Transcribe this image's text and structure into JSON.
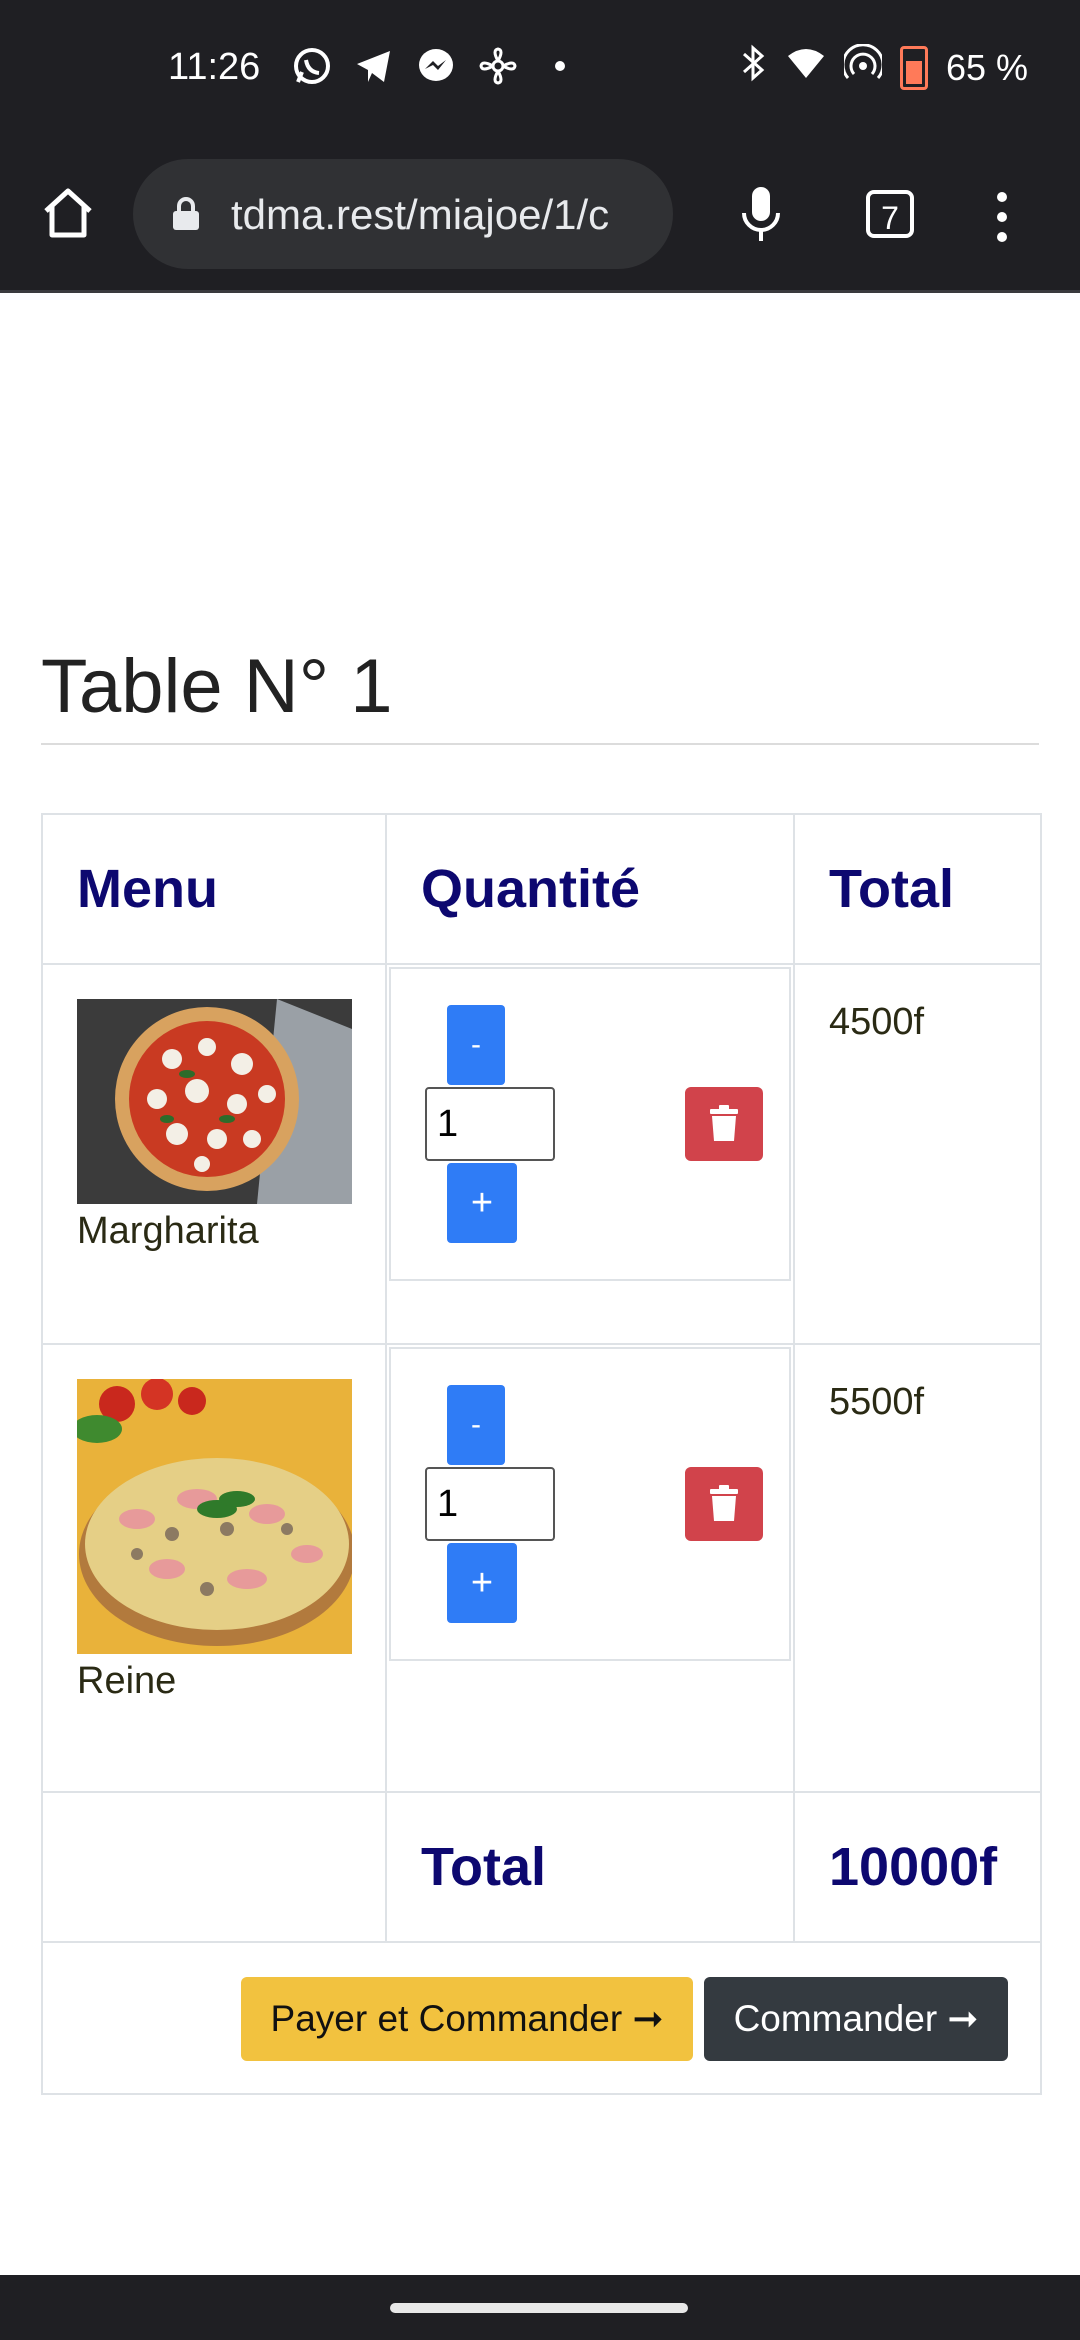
{
  "status_bar": {
    "time": "11:26",
    "battery": "65 %",
    "notification_icons": [
      "whatsapp-icon",
      "telegram-icon",
      "messenger-icon",
      "pinwheel-icon",
      "dot-icon"
    ],
    "system_icons": [
      "bluetooth-icon",
      "wifi-icon",
      "hotspot-icon",
      "battery-icon"
    ]
  },
  "browser": {
    "url": "tdma.rest/miajoe/1/c",
    "tab_count": "7"
  },
  "page": {
    "title": "Table N° 1",
    "table": {
      "headers": {
        "menu": "Menu",
        "quantity": "Quantité",
        "total": "Total"
      },
      "rows": [
        {
          "name": "Margharita",
          "quantity": "1",
          "price": "4500f",
          "minus": "-",
          "plus": "+"
        },
        {
          "name": "Reine",
          "quantity": "1",
          "price": "5500f",
          "minus": "-",
          "plus": "+"
        }
      ],
      "total_label": "Total",
      "total_value": "10000f"
    },
    "actions": {
      "pay_and_order": "Payer et Commander ➞",
      "order": "Commander ➞"
    }
  },
  "colors": {
    "header_text": "#0d0870",
    "button_blue": "#2f7cf6",
    "button_red": "#d1434b",
    "button_yellow": "#f2c23f",
    "button_dark": "#343a40"
  }
}
